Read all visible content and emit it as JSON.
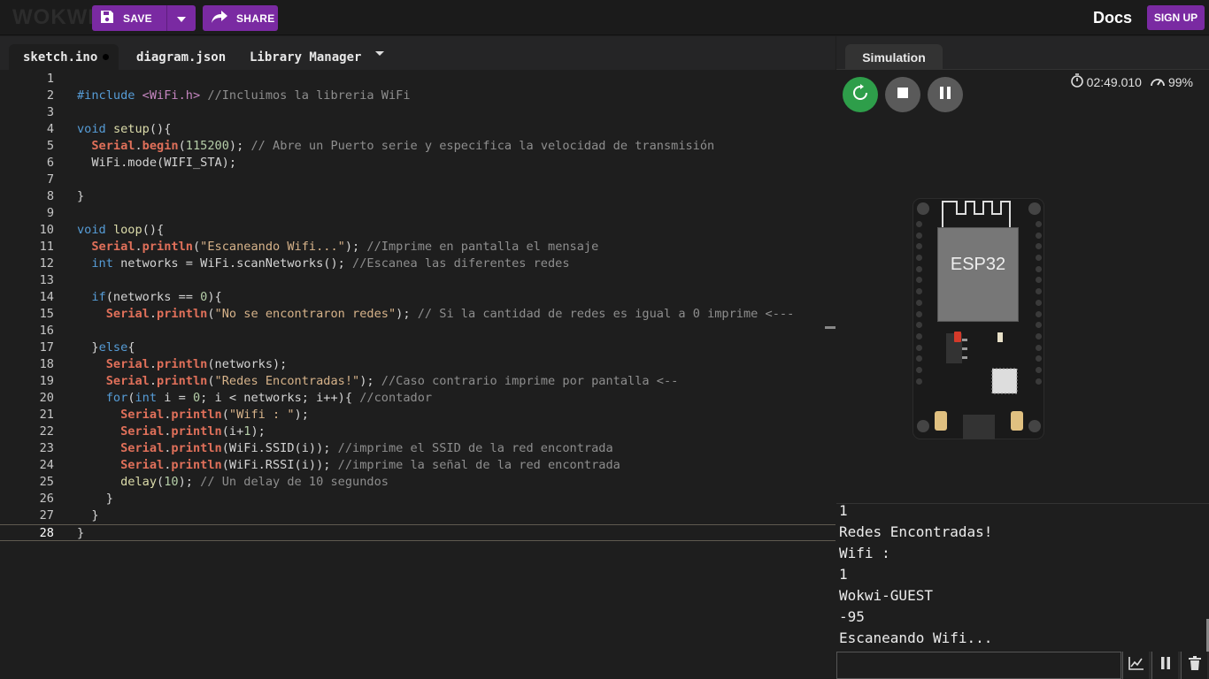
{
  "header": {
    "logo": "WOKWI",
    "save_label": "SAVE",
    "share_label": "SHARE",
    "docs_label": "Docs",
    "signup_label": "SIGN UP"
  },
  "editor_tabs": [
    {
      "label": "sketch.ino",
      "modified": true,
      "active": true
    },
    {
      "label": "diagram.json"
    },
    {
      "label": "Library Manager"
    }
  ],
  "code_lines": [
    "",
    "#include <WiFi.h> //Incluimos la libreria WiFi",
    "",
    "void setup(){",
    "  Serial.begin(115200); // Abre un Puerto serie y especifica la velocidad de transmisión",
    "  WiFi.mode(WIFI_STA);",
    "",
    "}",
    "",
    "void loop(){",
    "  Serial.println(\"Escaneando Wifi...\"); //Imprime en pantalla el mensaje",
    "  int networks = WiFi.scanNetworks(); //Escanea las diferentes redes",
    "",
    "  if(networks == 0){",
    "    Serial.println(\"No se encontraron redes\"); // Si la cantidad de redes es igual a 0 imprime <---",
    "",
    "  }else{",
    "    Serial.println(networks);",
    "    Serial.println(\"Redes Encontradas!\"); //Caso contrario imprime por pantalla <--",
    "    for(int i = 0; i < networks; i++){ //contador",
    "      Serial.println(\"Wifi : \");",
    "      Serial.println(i+1);",
    "      Serial.println(WiFi.SSID(i)); //imprime el SSID de la red encontrada",
    "      Serial.println(WiFi.RSSI(i)); //imprime la señal de la red encontrada",
    "      delay(10); // Un delay de 10 segundos",
    "    }",
    "  }",
    "}"
  ],
  "simulation": {
    "tab_label": "Simulation",
    "timer": "02:49.010",
    "speed": "99%",
    "board_label": "ESP32"
  },
  "serial_output": [
    "1",
    "Redes Encontradas!",
    "Wifi :",
    "1",
    "Wokwi-GUEST",
    "-95",
    "Escaneando Wifi..."
  ],
  "colors": {
    "accent": "#7a2aa2",
    "restart_button": "#2e9e4a"
  }
}
